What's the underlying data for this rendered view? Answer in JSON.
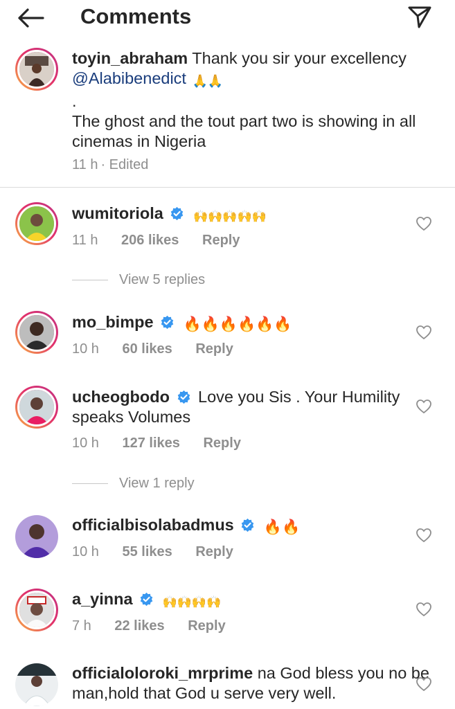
{
  "header": {
    "title": "Comments",
    "back_icon": "arrow-left-icon",
    "send_icon": "paper-plane-icon"
  },
  "caption": {
    "username": "toyin_abraham",
    "text_line1": "Thank you sir your excellency",
    "mention": "@Alabibenedict",
    "dot": ".",
    "body": "The ghost and the tout part two is showing in all cinemas in Nigeria",
    "time": "11 h",
    "edited": "· Edited",
    "emoji": "🙏🙏"
  },
  "comments": [
    {
      "username": "wumitoriola",
      "text": "",
      "emoji": "🙌🙌🙌🙌🙌",
      "time": "11 h",
      "likes": "206 likes",
      "reply": "Reply",
      "view_replies": "View 5 replies"
    },
    {
      "username": "mo_bimpe",
      "text": "",
      "emoji": "🔥🔥🔥🔥🔥🔥",
      "time": "10 h",
      "likes": "60 likes",
      "reply": "Reply"
    },
    {
      "username": "ucheogbodo",
      "text": "Love you Sis . Your Humility speaks Volumes",
      "time": "10 h",
      "likes": "127 likes",
      "reply": "Reply",
      "view_replies": "View 1 reply"
    },
    {
      "username": "officialbisolabadmus",
      "text": "",
      "emoji": "🔥🔥",
      "time": "10 h",
      "likes": "55 likes",
      "reply": "Reply"
    },
    {
      "username": "a_yinna",
      "text": "",
      "emoji": "🙌🙌🙌🙌",
      "time": "7 h",
      "likes": "22 likes",
      "reply": "Reply"
    },
    {
      "username": "officialoloroki_mrprime",
      "text": "na God bless you no be man,hold that God u serve very well."
    }
  ],
  "colors": {
    "text": "#262626",
    "muted": "#8e8e8e",
    "mention": "#1a3d7c",
    "verified": "#3897f0",
    "fire": "#f4511e",
    "clap": "#8d5524"
  }
}
